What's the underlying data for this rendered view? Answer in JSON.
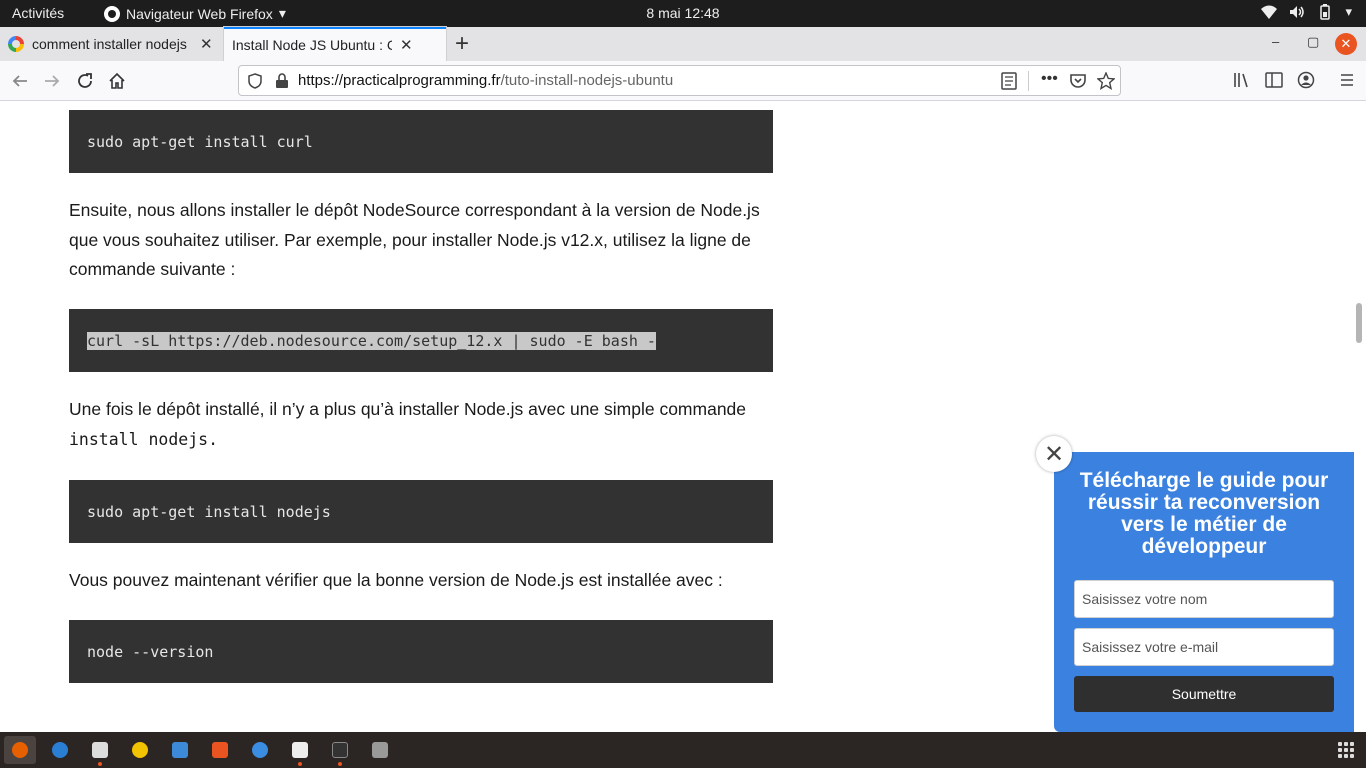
{
  "topbar": {
    "activities": "Activités",
    "app_menu": "Navigateur Web Firefox",
    "clock": "8 mai  12:48",
    "icons": [
      "wifi-icon",
      "volume-icon",
      "battery-icon",
      "power-menu-icon"
    ]
  },
  "tabs": [
    {
      "title": "comment installer nodejs",
      "favicon": "google-g-icon",
      "active": false
    },
    {
      "title": "Install Node JS Ubuntu : Comment",
      "active": true
    }
  ],
  "window": {
    "minimize": "–",
    "maximize": "▢",
    "close": "✕"
  },
  "navbar": {
    "url_domain": "https://practicalprogramming.fr",
    "url_path": "/tuto-install-nodejs-ubuntu"
  },
  "article": {
    "code1": "sudo apt-get install curl",
    "para1": "Ensuite, nous allons installer le dépôt NodeSource correspondant à la version de Node.js que vous souhaitez utiliser. Par exemple, pour installer Node.js v12.x, utilisez la ligne de commande suivante :",
    "code2": "curl -sL https://deb.nodesource.com/setup_12.x | sudo -E bash -",
    "para2_text": "Une fois le dépôt installé, il n’y a plus qu’à installer Node.js avec une simple commande",
    "para2_code": "install nodejs.",
    "code3": "sudo apt-get install nodejs",
    "para3": "Vous pouvez maintenant vérifier que la bonne version de Node.js est installée avec :",
    "code4": "node --version"
  },
  "popup": {
    "title": "Télécharge le guide pour réussir ta reconversion vers le métier de développeur",
    "name_placeholder": "Saisissez votre nom",
    "email_placeholder": "Saisissez votre e-mail",
    "submit": "Soumettre",
    "close": "✕"
  },
  "colors": {
    "popup_bg": "#3b82e0",
    "code_bg": "#323232",
    "accent": "#e95420"
  }
}
